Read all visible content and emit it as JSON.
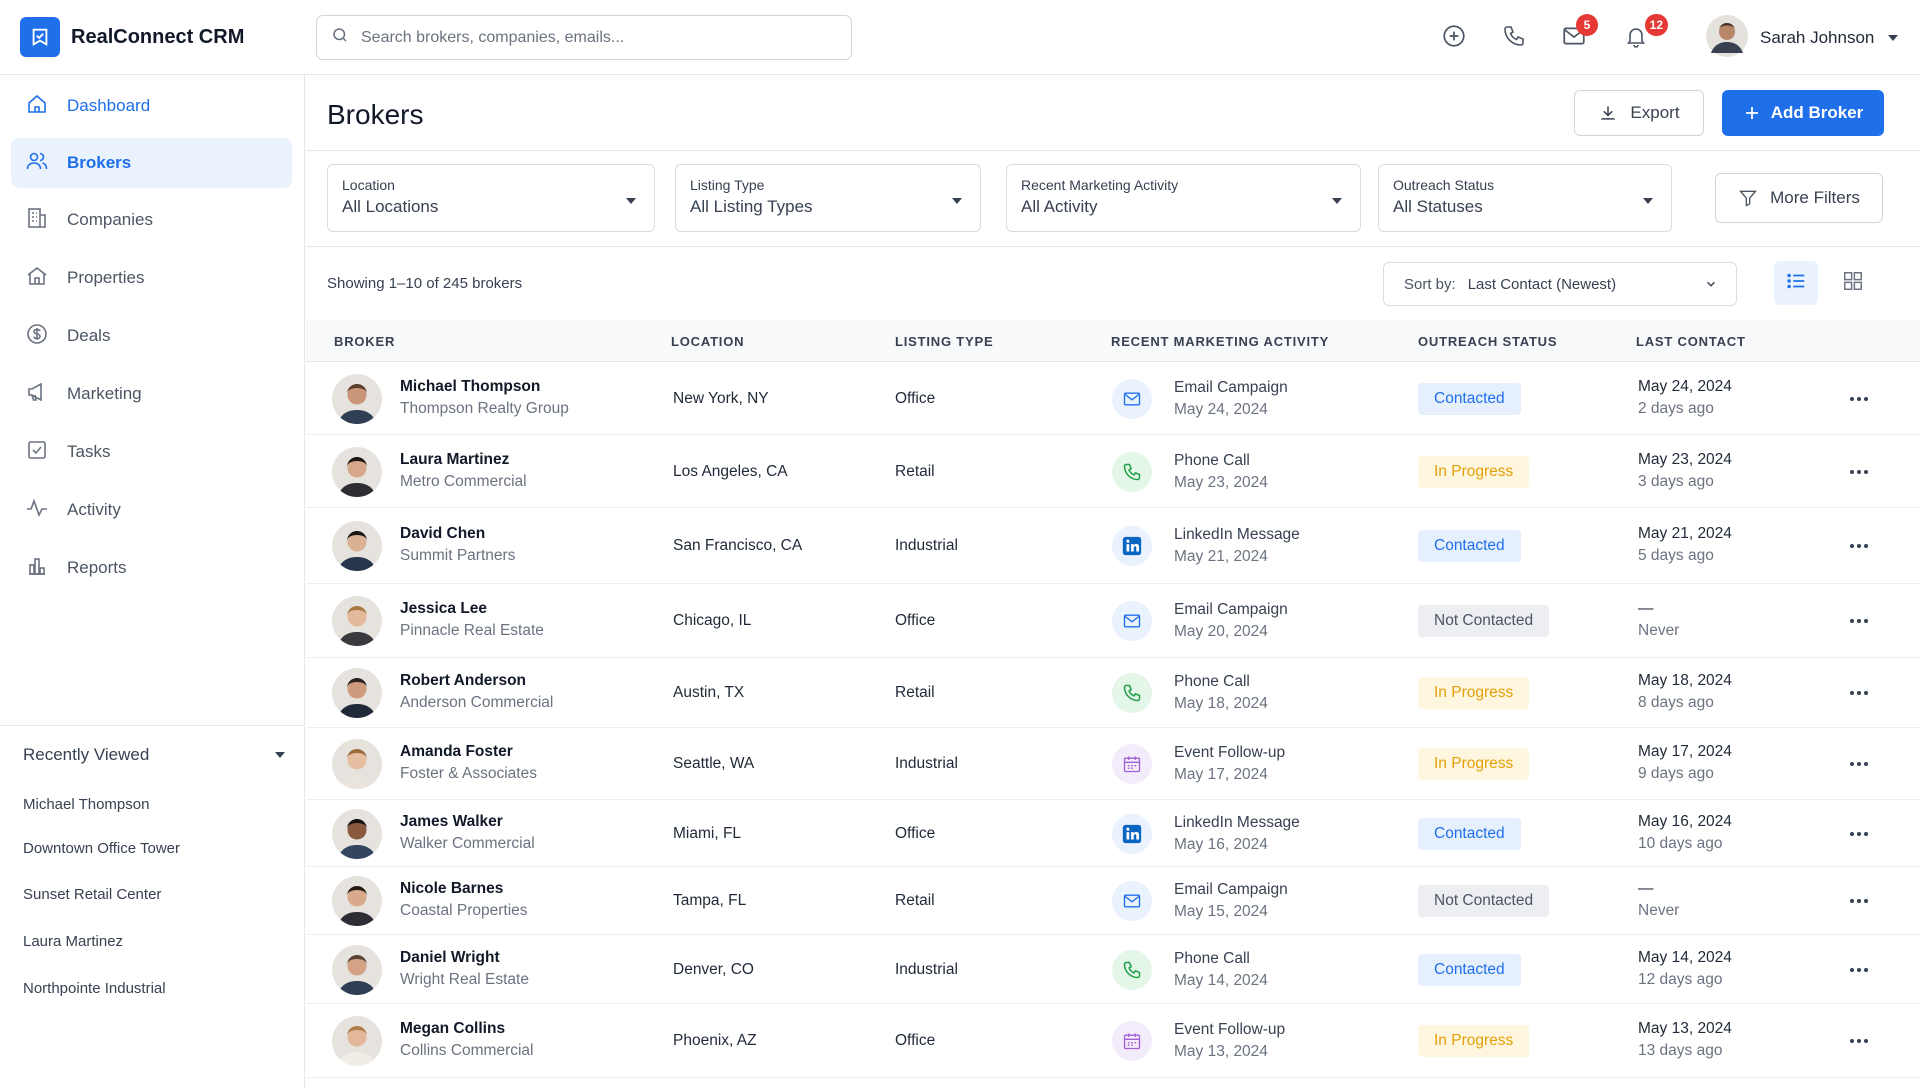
{
  "app": {
    "name": "RealConnect CRM",
    "accent": "#1f6feb"
  },
  "search": {
    "placeholder": "Search brokers, companies, emails..."
  },
  "header": {
    "mail_count": "5",
    "notification_count": "12",
    "user_name": "Sarah Johnson"
  },
  "sidebar": {
    "items": [
      {
        "label": "Dashboard",
        "icon": "home-icon"
      },
      {
        "label": "Brokers",
        "icon": "users-icon"
      },
      {
        "label": "Companies",
        "icon": "building-icon"
      },
      {
        "label": "Properties",
        "icon": "house-icon"
      },
      {
        "label": "Deals",
        "icon": "dollar-icon"
      },
      {
        "label": "Marketing",
        "icon": "megaphone-icon"
      },
      {
        "label": "Tasks",
        "icon": "checkbox-icon"
      },
      {
        "label": "Activity",
        "icon": "pulse-icon"
      },
      {
        "label": "Reports",
        "icon": "bar-chart-icon"
      }
    ],
    "active": "Brokers",
    "recent_title": "Recently Viewed",
    "recent": [
      "Michael Thompson",
      "Downtown Office Tower",
      "Sunset Retail Center",
      "Laura Martinez",
      "Northpointe Industrial"
    ]
  },
  "page": {
    "title": "Brokers",
    "export_label": "Export",
    "add_label": "Add Broker",
    "more_filters_label": "More Filters",
    "showing": "Showing 1–10 of 245 brokers",
    "sort_label": "Sort by:",
    "sort_value": "Last Contact (Newest)"
  },
  "filters": [
    {
      "label": "Location",
      "value": "All Locations"
    },
    {
      "label": "Listing Type",
      "value": "All Listing Types"
    },
    {
      "label": "Recent Marketing Activity",
      "value": "All Activity"
    },
    {
      "label": "Outreach Status",
      "value": "All Statuses"
    }
  ],
  "table": {
    "columns": [
      "BROKER",
      "LOCATION",
      "LISTING TYPE",
      "RECENT MARKETING ACTIVITY",
      "OUTREACH STATUS",
      "LAST CONTACT"
    ],
    "rows": [
      {
        "name": "Michael Thompson",
        "company": "Thompson Realty Group",
        "location": "New York, NY",
        "listing": "Office",
        "activity": "Email Campaign",
        "activity_date": "May 24, 2024",
        "activity_icon": "mail-icon",
        "status": "Contacted",
        "last_contact": "May 24, 2024",
        "ago": "2 days ago"
      },
      {
        "name": "Laura Martinez",
        "company": "Metro Commercial",
        "location": "Los Angeles, CA",
        "listing": "Retail",
        "activity": "Phone Call",
        "activity_date": "May 23, 2024",
        "activity_icon": "phone-icon",
        "status": "In Progress",
        "last_contact": "May 23, 2024",
        "ago": "3 days ago"
      },
      {
        "name": "David Chen",
        "company": "Summit Partners",
        "location": "San Francisco, CA",
        "listing": "Industrial",
        "activity": "LinkedIn Message",
        "activity_date": "May 21, 2024",
        "activity_icon": "linkedin-icon",
        "status": "Contacted",
        "last_contact": "May 21, 2024",
        "ago": "5 days ago"
      },
      {
        "name": "Jessica Lee",
        "company": "Pinnacle Real Estate",
        "location": "Chicago, IL",
        "listing": "Office",
        "activity": "Email Campaign",
        "activity_date": "May 20, 2024",
        "activity_icon": "mail-icon",
        "status": "Not Contacted",
        "last_contact": "—",
        "ago": "Never"
      },
      {
        "name": "Robert Anderson",
        "company": "Anderson Commercial",
        "location": "Austin, TX",
        "listing": "Retail",
        "activity": "Phone Call",
        "activity_date": "May 18, 2024",
        "activity_icon": "phone-icon",
        "status": "In Progress",
        "last_contact": "May 18, 2024",
        "ago": "8 days ago"
      },
      {
        "name": "Amanda Foster",
        "company": "Foster & Associates",
        "location": "Seattle, WA",
        "listing": "Industrial",
        "activity": "Event Follow-up",
        "activity_date": "May 17, 2024",
        "activity_icon": "calendar-icon",
        "status": "In Progress",
        "last_contact": "May 17, 2024",
        "ago": "9 days ago"
      },
      {
        "name": "James Walker",
        "company": "Walker Commercial",
        "location": "Miami, FL",
        "listing": "Office",
        "activity": "LinkedIn Message",
        "activity_date": "May 16, 2024",
        "activity_icon": "linkedin-icon",
        "status": "Contacted",
        "last_contact": "May 16, 2024",
        "ago": "10 days ago"
      },
      {
        "name": "Nicole Barnes",
        "company": "Coastal Properties",
        "location": "Tampa, FL",
        "listing": "Retail",
        "activity": "Email Campaign",
        "activity_date": "May 15, 2024",
        "activity_icon": "mail-icon",
        "status": "Not Contacted",
        "last_contact": "—",
        "ago": "Never"
      },
      {
        "name": "Daniel Wright",
        "company": "Wright Real Estate",
        "location": "Denver, CO",
        "listing": "Industrial",
        "activity": "Phone Call",
        "activity_date": "May 14, 2024",
        "activity_icon": "phone-icon",
        "status": "Contacted",
        "last_contact": "May 14, 2024",
        "ago": "12 days ago"
      },
      {
        "name": "Megan Collins",
        "company": "Collins Commercial",
        "location": "Phoenix, AZ",
        "listing": "Office",
        "activity": "Event Follow-up",
        "activity_date": "May 13, 2024",
        "activity_icon": "calendar-icon",
        "status": "In Progress",
        "last_contact": "May 13, 2024",
        "ago": "13 days ago"
      }
    ]
  }
}
